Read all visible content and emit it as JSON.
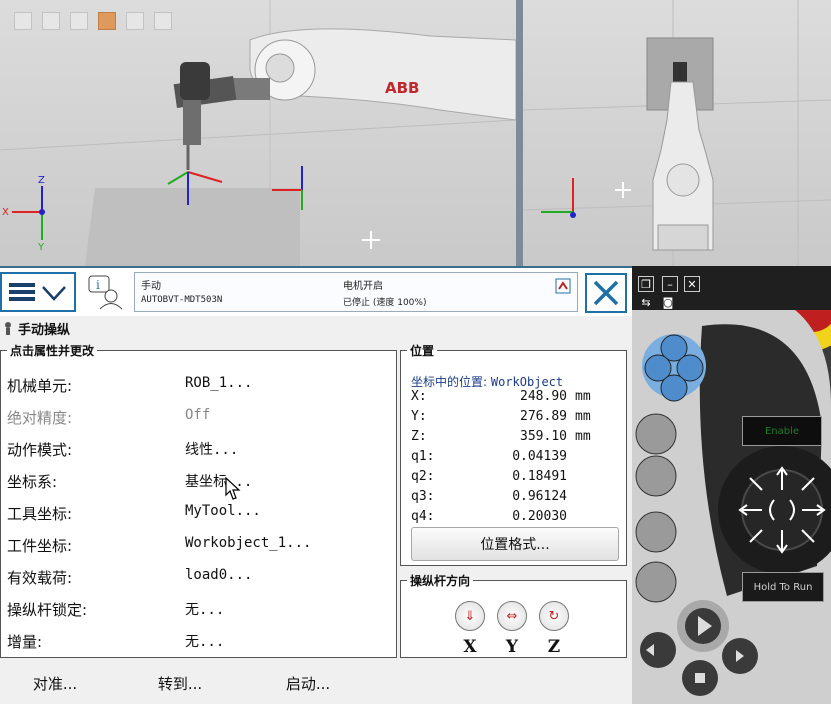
{
  "viewports": {
    "left": {
      "logo": "ABB"
    },
    "toolbar_icons": [
      "view-icon",
      "grid-icon",
      "select-icon",
      "snap-icon",
      "measure-icon",
      "target-icon"
    ]
  },
  "header": {
    "menu_icon": "hamburger-menu-icon",
    "info_icon": "info-user-icon",
    "status": {
      "mode": "手动",
      "system": "AUTOBVT-MDT503N",
      "motors": "电机开启",
      "state": "已停止 (速度 100%)"
    },
    "close_icon": "close-icon"
  },
  "page": {
    "title": "手动操纵"
  },
  "properties": {
    "legend": "点击属性并更改",
    "rows": [
      {
        "label": "机械单元:",
        "value": "ROB_1...",
        "enabled": true
      },
      {
        "label": "绝对精度:",
        "value": "Off",
        "enabled": false
      },
      {
        "label": "动作模式:",
        "value": "线性...",
        "enabled": true
      },
      {
        "label": "坐标系:",
        "value": "基坐标...",
        "enabled": true
      },
      {
        "label": "工具坐标:",
        "value": "MyTool...",
        "enabled": true
      },
      {
        "label": "工件坐标:",
        "value": "Workobject_1...",
        "enabled": true
      },
      {
        "label": "有效载荷:",
        "value": "load0...",
        "enabled": true
      },
      {
        "label": "操纵杆锁定:",
        "value": "无...",
        "enabled": true
      },
      {
        "label": "增量:",
        "value": "无...",
        "enabled": true
      }
    ]
  },
  "position": {
    "legend": "位置",
    "subtitle_prefix": "坐标中的位置:",
    "subtitle_frame": "WorkObject",
    "rows": [
      {
        "key": "X:",
        "value": "248.90",
        "unit": "mm"
      },
      {
        "key": "Y:",
        "value": "276.89",
        "unit": "mm"
      },
      {
        "key": "Z:",
        "value": "359.10",
        "unit": "mm"
      },
      {
        "key": "q1:",
        "value": "0.04139",
        "unit": ""
      },
      {
        "key": "q2:",
        "value": "0.18491",
        "unit": ""
      },
      {
        "key": "q3:",
        "value": "0.96124",
        "unit": ""
      },
      {
        "key": "q4:",
        "value": "0.20030",
        "unit": ""
      }
    ],
    "format_button": "位置格式..."
  },
  "joystick": {
    "legend": "操纵杆方向",
    "axes": [
      "X",
      "Y",
      "Z"
    ]
  },
  "commands": [
    "对准...",
    "转到...",
    "启动..."
  ],
  "hardware": {
    "enable_label": "Enable",
    "hold_label": "Hold To Run",
    "accent_color": "#f2d21b"
  }
}
